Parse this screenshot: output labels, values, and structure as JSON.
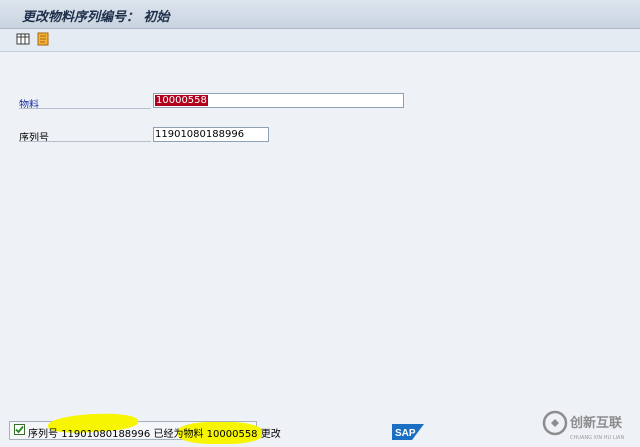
{
  "window": {
    "title": "更改物料序列编号： 初始"
  },
  "toolbar": {
    "buttons": [
      {
        "icon": "grid-icon"
      },
      {
        "icon": "change-icon"
      }
    ]
  },
  "form": {
    "material": {
      "label": "物料",
      "value": "10000558"
    },
    "serial": {
      "label": "序列号",
      "value": "11901080188996"
    }
  },
  "status": {
    "prefix": "序列号",
    "serial": "11901080188996",
    "mid": "已经为物料",
    "material": "10000558",
    "suffix": "更改"
  },
  "branding": {
    "sap_logo": "SAP",
    "watermark_cn": "创新互联",
    "watermark_en": "CHUANG XIN HU LIAN"
  },
  "colors": {
    "selection": "#b0001c",
    "label_blue": "#1b2fa8",
    "highlight": "#f7f600",
    "sap_blue": "#1a6fc3"
  }
}
